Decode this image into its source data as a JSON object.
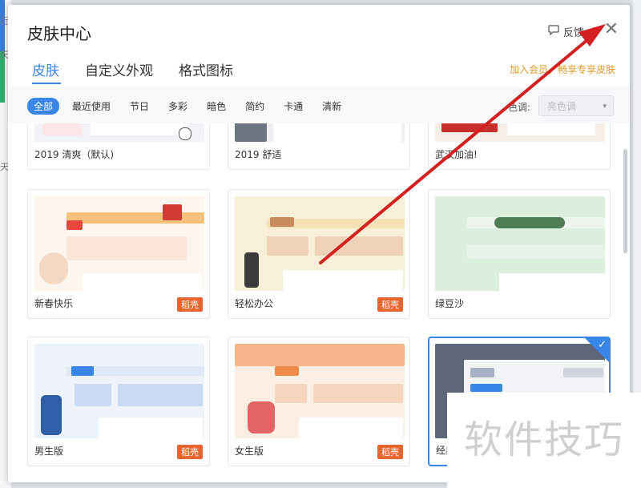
{
  "dialog": {
    "title": "皮肤中心",
    "feedback_label": "反馈",
    "close_glyph": "✕",
    "promo_text": "加入会员，畅享专享皮肤"
  },
  "tabs": [
    {
      "label": "皮肤",
      "active": true
    },
    {
      "label": "自定义外观",
      "active": false
    },
    {
      "label": "格式图标",
      "active": false
    }
  ],
  "filters": {
    "chips": [
      "全部",
      "最近使用",
      "节日",
      "多彩",
      "暗色",
      "简约",
      "卡通",
      "清新"
    ],
    "active_index": 0,
    "tone_label": "色调:",
    "tone_placeholder": "亮色调",
    "tone_arrow": "▾"
  },
  "skins_top_row": [
    {
      "name": "2019 清爽（默认)"
    },
    {
      "name": "2019 舒适"
    },
    {
      "name": "武汉加油!"
    }
  ],
  "skins_middle_row": [
    {
      "name": "新春快乐",
      "badge": "稻壳"
    },
    {
      "name": "轻松办公",
      "badge": "稻壳"
    },
    {
      "name": "绿豆沙",
      "badge": ""
    }
  ],
  "skins_bottom_row": [
    {
      "name": "男生版",
      "badge": "稻壳"
    },
    {
      "name": "女生版",
      "badge": "稻壳"
    },
    {
      "name": "经典",
      "badge": "",
      "selected": true
    }
  ],
  "watermark": "软件技巧",
  "check_glyph": "✓",
  "colors": {
    "accent": "#3a86e8",
    "promo": "#e29a2a",
    "badge": "#e9642e",
    "annotation_arrow": "#d42020"
  }
}
